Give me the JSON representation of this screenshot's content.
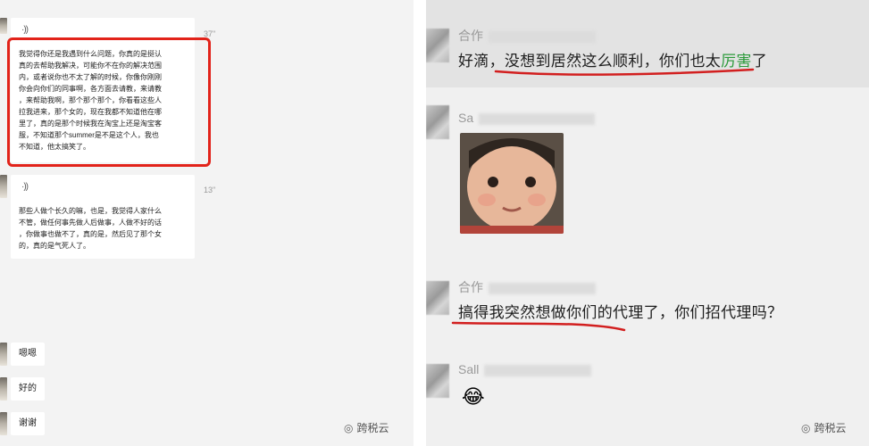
{
  "left_chat": {
    "voice_messages": [
      {
        "icon": "voice-icon",
        "duration": "37\"",
        "transcript_lines": [
          "我觉得你还是我遇到什么问题，你真的是挺认",
          "真的去帮助我解决，可能你不在你的解决范围",
          "内，或者说你也不太了解的时候，你像你刚刚",
          "你会向你们的同事啊，各方面去请教，来请教",
          "，来帮助我啊，那个那个那个，你看看这些人",
          "拉我进来，那个女的，现在我都不知道他在哪",
          "里了，真的是那个时候我在淘宝上还是淘宝客",
          "服，不知道那个summer是不是这个人，我也",
          "不知道，他太搞笑了。"
        ]
      },
      {
        "icon": "voice-icon",
        "duration": "13\"",
        "transcript_lines": [
          "那些人做个长久的嘛，也是，我觉得人家什么",
          "不管，做任何事先做人后做事，人做不好的话",
          "，你做事也做不了，真的是，然后见了那个女",
          "的，真的是气死人了。"
        ]
      }
    ],
    "short_messages": [
      "嗯嗯",
      "好的",
      "谢谢"
    ],
    "watermark": "跨税云"
  },
  "right_chat": {
    "messages": [
      {
        "sender": "合作",
        "text_plain": "好滴，没想到居然这么顺利，你们也太",
        "text_green": "厉害",
        "text_tail": "了"
      },
      {
        "sender": "Sa",
        "type": "sticker"
      },
      {
        "sender": "合作",
        "text": "搞得我突然想做你们的代理了，你们招代理吗？"
      },
      {
        "sender": "Sall",
        "type": "emoji",
        "emoji": "😂"
      }
    ],
    "watermark": "跨税云"
  },
  "colors": {
    "highlight_red": "#e2231a",
    "accent_green": "#2b9a3a",
    "underline_red": "#d21f1f"
  }
}
